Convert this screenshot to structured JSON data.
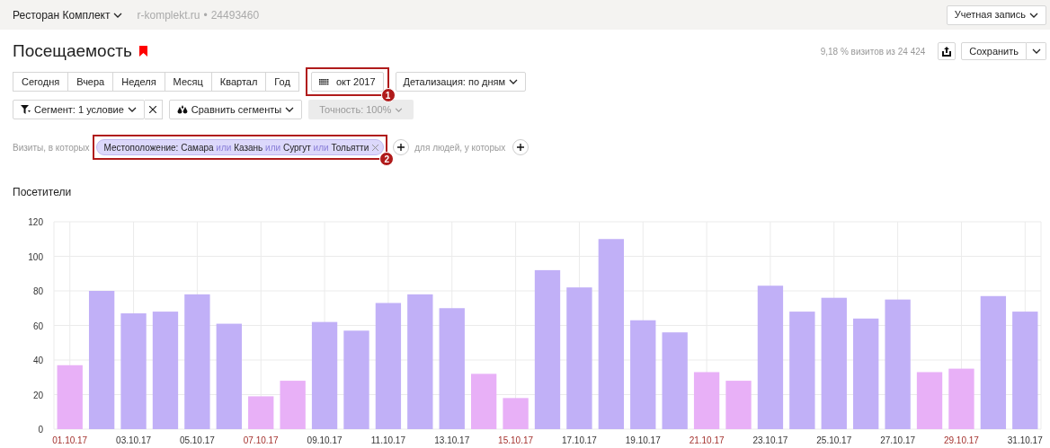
{
  "top_bar": {
    "counter_name": "Ресторан Комплект",
    "site": "r-komplekt.ru",
    "separator": "•",
    "counter_id": "24493460",
    "account_button": "Учетная запись"
  },
  "header": {
    "title": "Посещаемость",
    "bookmarked": true,
    "share_text": "9,18 % визитов из 24 424",
    "save_button": "Сохранить"
  },
  "periods": [
    {
      "label": "Сегодня",
      "selected": false
    },
    {
      "label": "Вчера",
      "selected": false
    },
    {
      "label": "Неделя",
      "selected": false
    },
    {
      "label": "Месяц",
      "selected": false
    },
    {
      "label": "Квартал",
      "selected": false
    },
    {
      "label": "Год",
      "selected": false
    }
  ],
  "date_button": {
    "label": "окт 2017",
    "callout": "1"
  },
  "detail_dropdown": "Детализация: по дням",
  "segment_dropdown": "Сегмент: 1 условие",
  "compare_dropdown": "Сравнить сегменты",
  "accuracy_dropdown": {
    "label": "Точность: 100%",
    "disabled": true
  },
  "filter": {
    "prefix": "Визиты, в которых",
    "field": "Местоположение:",
    "values": [
      "Самара",
      "Казань",
      "Сургут",
      "Тольятти"
    ],
    "connectors": [
      "или",
      "или",
      "или"
    ],
    "callout": "2",
    "people_label": "для людей, у которых"
  },
  "chart_title": "Посетители",
  "chart_data": {
    "type": "bar",
    "stacked": true,
    "categories": [
      "01.10.17",
      null,
      "03.10.17",
      null,
      "05.10.17",
      null,
      "07.10.17",
      null,
      "09.10.17",
      null,
      "11.10.17",
      null,
      "13.10.17",
      null,
      "15.10.17",
      null,
      "17.10.17",
      null,
      "19.10.17",
      null,
      "21.10.17",
      null,
      "23.10.17",
      null,
      "25.10.17",
      null,
      "27.10.17",
      null,
      "29.10.17",
      null,
      "31.10.17"
    ],
    "series": [
      {
        "color": "#c1b0f7",
        "values": [
          null,
          80,
          67,
          68,
          78,
          61,
          null,
          null,
          62,
          57,
          73,
          78,
          70,
          null,
          null,
          92,
          82,
          110,
          63,
          56,
          null,
          null,
          83,
          68,
          76,
          64,
          75,
          null,
          null,
          77,
          68
        ]
      },
      {
        "color": "#e8b0f7",
        "values": [
          37,
          null,
          null,
          null,
          null,
          null,
          19,
          28,
          null,
          null,
          null,
          null,
          null,
          32,
          18,
          null,
          null,
          null,
          null,
          null,
          33,
          28,
          null,
          null,
          null,
          null,
          null,
          33,
          35,
          null,
          null
        ]
      }
    ],
    "grid": true,
    "ylim": [
      0,
      120
    ],
    "yticks": [
      0,
      20,
      40,
      60,
      80,
      100,
      120
    ]
  }
}
